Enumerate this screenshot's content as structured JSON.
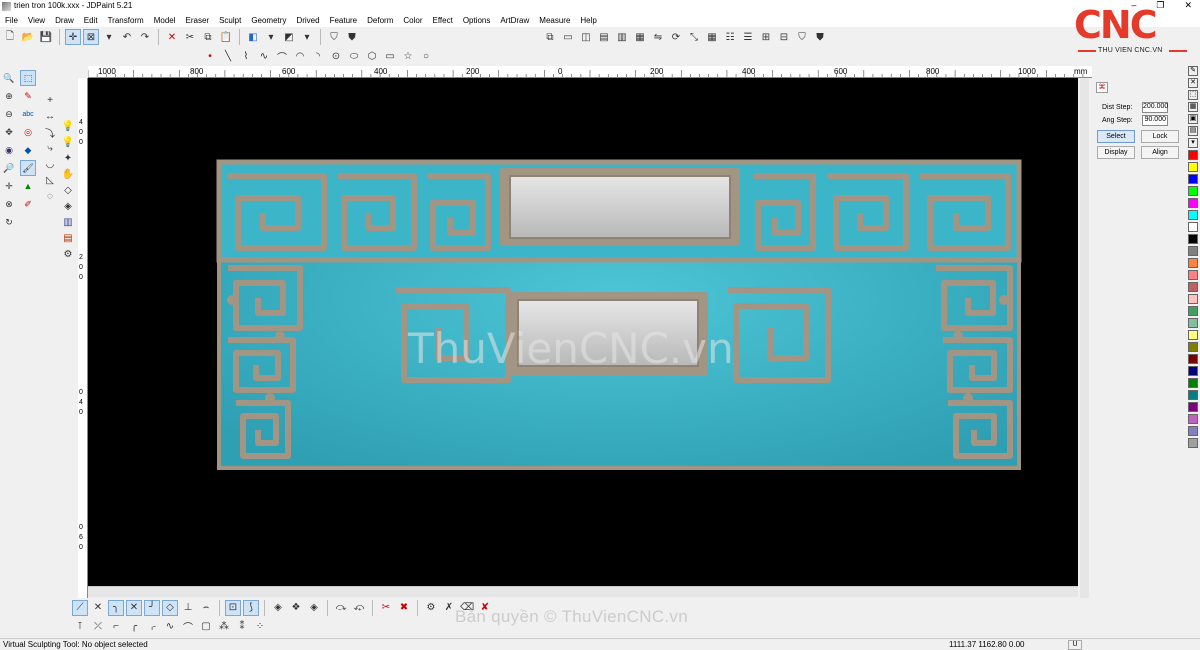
{
  "window": {
    "title": "trien tron 100k.xxx - JDPaint 5.21",
    "controls": [
      "–",
      "❐",
      "✕"
    ]
  },
  "menu": [
    "File",
    "View",
    "Draw",
    "Edit",
    "Transform",
    "Model",
    "Eraser",
    "Sculpt",
    "Geometry",
    "Drived",
    "Feature",
    "Deform",
    "Color",
    "Effect",
    "Options",
    "ArtDraw",
    "Measure",
    "Help"
  ],
  "logo": {
    "text": "CNC",
    "subtitle": "THU VIEN CNC.VN"
  },
  "ruler": {
    "top_labels": [
      "1000",
      "800",
      "600",
      "400",
      "200",
      "0",
      "200",
      "400",
      "600",
      "800",
      "1000"
    ],
    "unit": "mm",
    "left_labels": [
      "4",
      "0",
      "0",
      "2",
      "0",
      "0",
      "0",
      "4",
      "0",
      "0",
      "6",
      "0"
    ]
  },
  "panel": {
    "dist_label": "Dist Step:",
    "dist_value": "200.000",
    "ang_label": "Ang Step:",
    "ang_value": "90.000",
    "select": "Select",
    "lock": "Lock",
    "display": "Display",
    "align": "Align"
  },
  "colors": [
    "#ff0000",
    "#ffff00",
    "#0000ff",
    "#00ff00",
    "#ff00ff",
    "#00ffff",
    "#ffffff",
    "#000000",
    "#808080",
    "#ff8040",
    "#ff8080",
    "#c06060",
    "#ffc0c0",
    "#40a060",
    "#80c0a0",
    "#ffff80",
    "#808000",
    "#800000",
    "#000080",
    "#008000",
    "#008080",
    "#800080",
    "#c060c0",
    "#8080c0",
    "#a0a0a0"
  ],
  "canvas": {
    "background": "#000000",
    "field": "#3cb7c9",
    "frame": "#a39584",
    "watermark": "ThuVienCNC.vn"
  },
  "watermark_bottom": "Bản quyền © ThuVienCNC.vn",
  "status": {
    "message": "Virtual Sculpting Tool: No object selected",
    "coords": "1111.37 1162.80 0.00",
    "unit": "U"
  }
}
